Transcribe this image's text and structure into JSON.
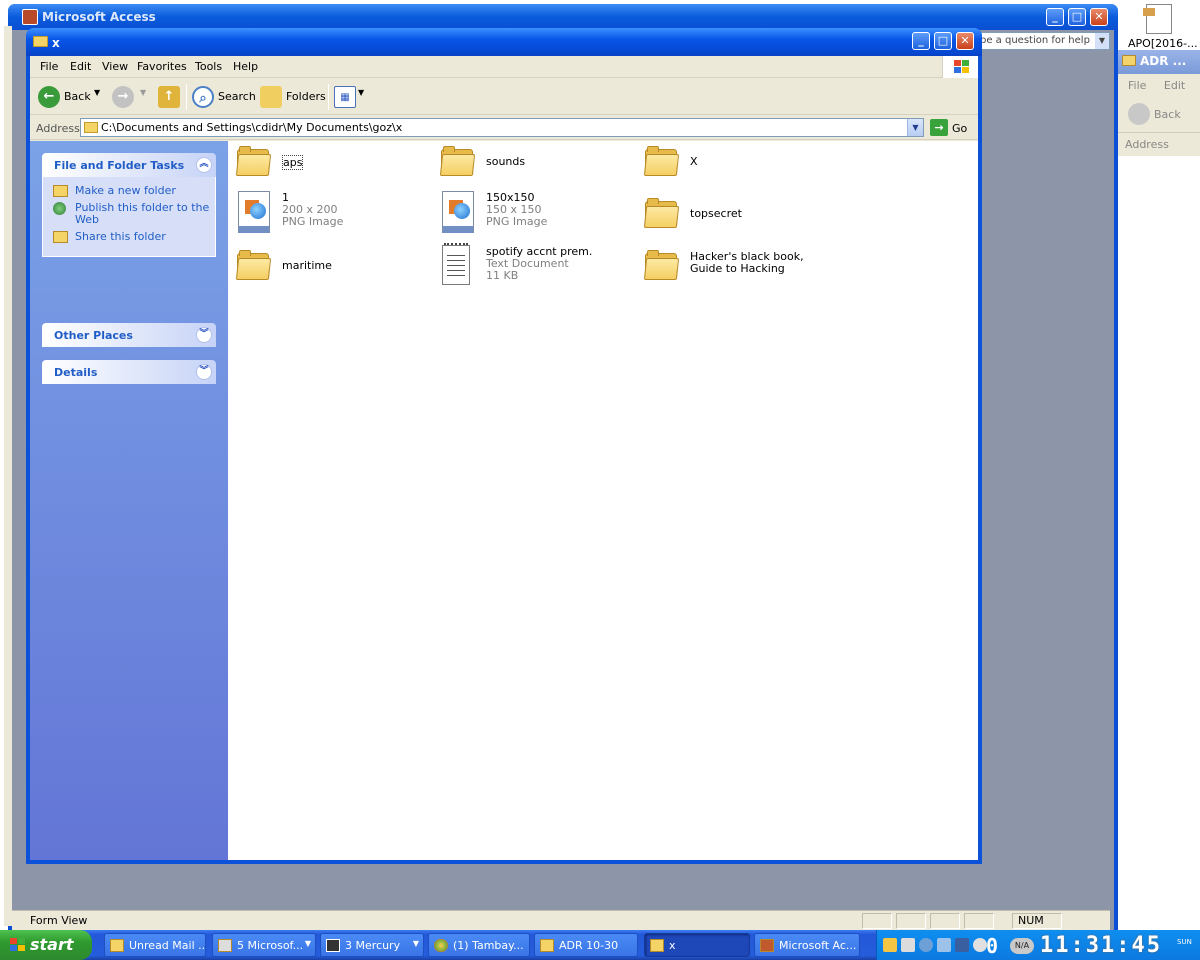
{
  "access": {
    "title": "Microsoft Access",
    "ask_placeholder": "pe a question for help",
    "status_left": "Form View",
    "status_num": "NUM"
  },
  "desktop": {
    "pdf_label": "APO[2016-..."
  },
  "right_window": {
    "title": "ADR ...",
    "menu": "File Edit",
    "back_label": "Back",
    "address_label": "Address"
  },
  "explorer": {
    "title": "x",
    "menu": [
      "File",
      "Edit",
      "View",
      "Favorites",
      "Tools",
      "Help"
    ],
    "toolbar": {
      "back": "Back",
      "search": "Search",
      "folders": "Folders"
    },
    "address": {
      "label": "Address",
      "value": "C:\\Documents and Settings\\cdidr\\My Documents\\goz\\x",
      "go": "Go"
    },
    "tasks": {
      "file_folder_title": "File and Folder Tasks",
      "links": [
        "Make a new folder",
        "Publish this folder to the Web",
        "Share this folder"
      ],
      "other_places": "Other Places",
      "details": "Details"
    },
    "files": [
      {
        "name": "aps",
        "kind": "folder"
      },
      {
        "name": "sounds",
        "kind": "folder"
      },
      {
        "name": "X",
        "kind": "folder"
      },
      {
        "name": "1",
        "kind": "png",
        "dims": "200 x 200",
        "type": "PNG Image"
      },
      {
        "name": "150x150",
        "kind": "png",
        "dims": "150 x 150",
        "type": "PNG Image"
      },
      {
        "name": "topsecret",
        "kind": "folder"
      },
      {
        "name": "maritime",
        "kind": "folder"
      },
      {
        "name": "spotify accnt prem.",
        "kind": "text",
        "type": "Text Document",
        "size": "11 KB"
      },
      {
        "name": "Hacker's black book, Guide to Hacking",
        "kind": "folder"
      }
    ]
  },
  "taskbar": {
    "start": "start",
    "tasks": [
      {
        "label": "Unread Mail ..."
      },
      {
        "label": "5 Microsof..."
      },
      {
        "label": "3 Mercury"
      },
      {
        "label": "(1) Tambay..."
      },
      {
        "label": "ADR 10-30"
      },
      {
        "label": "x"
      },
      {
        "label": "Microsoft Ac..."
      }
    ],
    "clock": "11:31:45",
    "clock_prefix": "0",
    "clock_na": "N/A",
    "clock_day": "SUN"
  },
  "colors": {
    "xp_blue": "#0b52d8",
    "taskpane": "#6375d6",
    "link": "#215dc6",
    "start_green": "#2f9a2f"
  }
}
